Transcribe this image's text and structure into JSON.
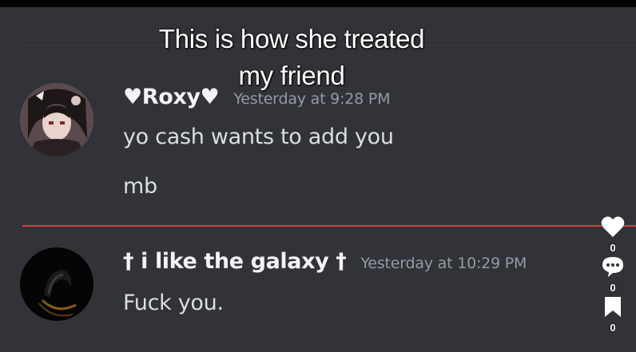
{
  "caption": {
    "line1": "This is how she treated",
    "line2": "my friend"
  },
  "messages": [
    {
      "username": "♥Roxy♥",
      "timestamp": "Yesterday at 9:28 PM",
      "lines": [
        "yo cash wants to add you",
        "mb"
      ]
    },
    {
      "username": "† i like the galaxy †",
      "timestamp": "Yesterday at 10:29 PM",
      "lines": [
        "Fuck you."
      ]
    }
  ],
  "side_actions": {
    "likes": "0",
    "comments": "0",
    "saves": "0"
  },
  "colors": {
    "background": "#313338",
    "new_messages_divider": "#d04040",
    "username": "#f2f3f5",
    "timestamp": "#949ba4",
    "message_text": "#dbdee1"
  },
  "icons": [
    "heart-icon",
    "comment-bubble-icon",
    "bookmark-icon"
  ]
}
